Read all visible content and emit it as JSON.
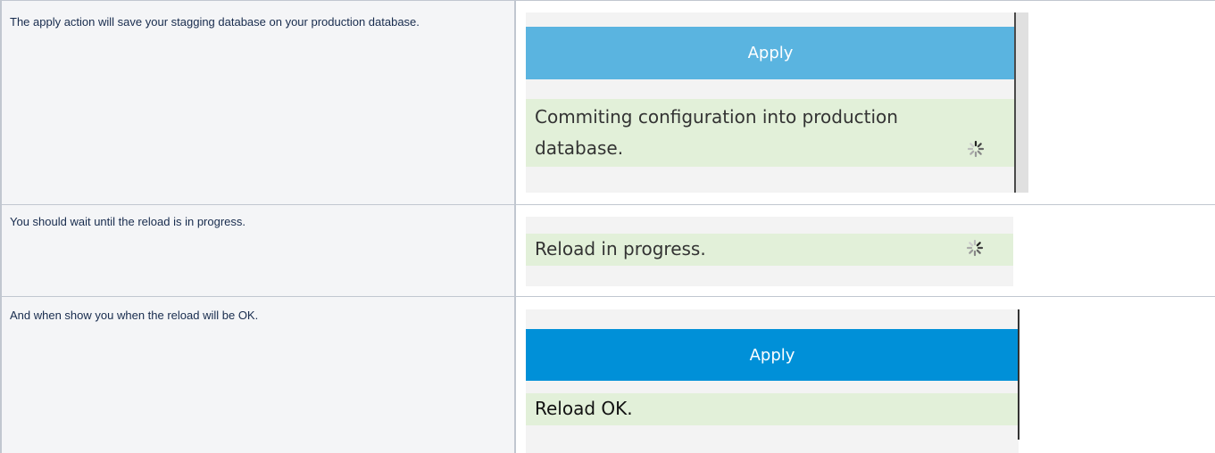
{
  "rows": [
    {
      "description": "The apply action will save your stagging database on your production database.",
      "screenshot": {
        "button_label": "Apply",
        "button_color": "#5ab4e0",
        "status_text": "Commiting configuration into production database.",
        "spinner": "loading-spinner-icon"
      }
    },
    {
      "description": "You should wait until the reload is in progress.",
      "screenshot": {
        "status_text": "Reload in progress.",
        "spinner": "loading-spinner-icon"
      }
    },
    {
      "description": "And when show you when the reload will be OK.",
      "screenshot": {
        "button_label": "Apply",
        "button_color": "#0090d8",
        "status_text": "Reload OK."
      }
    }
  ],
  "colors": {
    "border": "#c1c7d0",
    "description_bg": "#f4f5f7",
    "status_bg": "#e2f0d9"
  }
}
